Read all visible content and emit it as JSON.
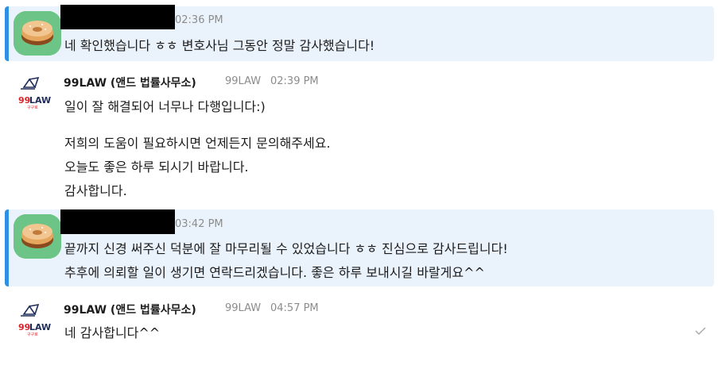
{
  "messages": [
    {
      "time": "02:36 PM",
      "lines": [
        "네 확인했습니다 ㅎㅎ 변호사님 그동안 정말 감사했습니다!"
      ]
    },
    {
      "name": "99LAW (앤드 법률사무소)",
      "handle": "99LAW",
      "time": "02:39 PM",
      "lines": [
        "일이 잘 해결되어 너무나 다행입니다:)",
        "저희의 도움이 필요하시면 언제든지 문의해주세요.",
        "오늘도 좋은 하루 되시기 바랍니다.",
        "감사합니다."
      ]
    },
    {
      "time": "03:42 PM",
      "lines": [
        "끝까지 신경 써주신 덕분에 잘 마무리될 수 있었습니다 ㅎㅎ 진심으로 감사드립니다!",
        "추후에 의뢰할 일이 생기면 연락드리겠습니다. 좋은 하루 보내시길 바랄게요^^"
      ]
    },
    {
      "name": "99LAW (앤드 법률사무소)",
      "handle": "99LAW",
      "time": "04:57 PM",
      "lines": [
        "네 감사합니다^^"
      ]
    }
  ],
  "logo": {
    "text": "99LAW",
    "sub": "구구로",
    "color_red": "#d8232a",
    "color_navy": "#1f2d5a"
  },
  "icons": {
    "user_avatar": "bagel-avatar-icon",
    "firm_logo": "99law-logo-icon",
    "read_receipt": "check-icon"
  },
  "colors": {
    "highlight_bg": "#eaf3fb",
    "highlight_bar": "#2f8fe0",
    "avatar_bg": "#6cc486"
  }
}
